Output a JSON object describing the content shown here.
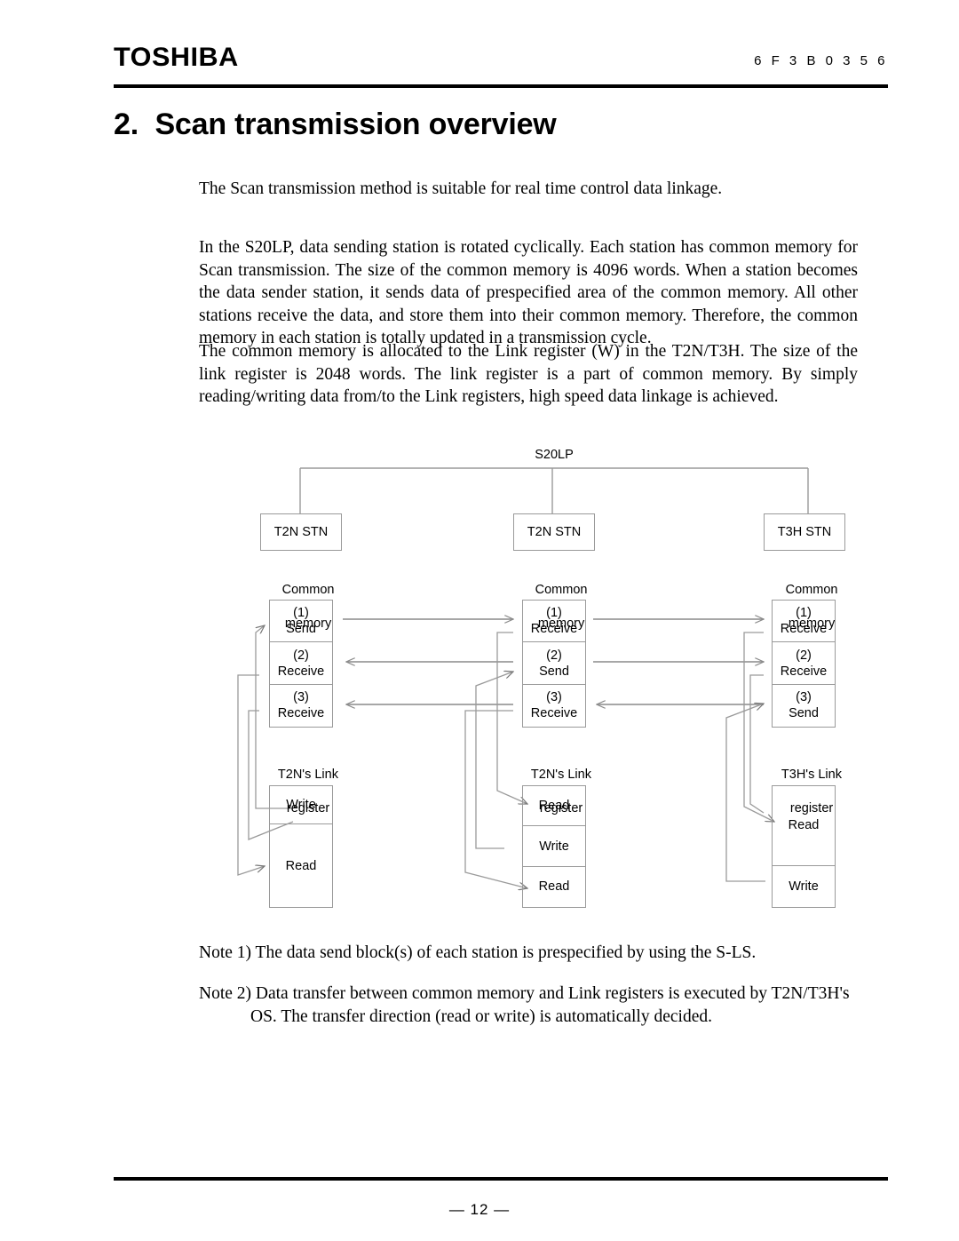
{
  "header": {
    "brand": "TOSHIBA",
    "doc_code": "6 F 3 B 0 3 5 6"
  },
  "title": "2.  Scan transmission overview",
  "paragraphs": {
    "p1": "The Scan transmission method is suitable for real time control data linkage.",
    "p2": "In the S20LP, data sending station is rotated cyclically. Each station has common memory for Scan transmission. The size of the common memory is 4096 words. When a station becomes the data sender station, it sends data of prespecified area of the common memory. All other stations receive the data, and store them into their common memory. Therefore, the common memory in each station is totally updated in a transmission cycle.",
    "p3": "The common memory is allocated to the Link register (W) in the T2N/T3H. The size of the link register is 2048 words. The link register is a part of common memory. By simply reading/writing data from/to the Link registers, high speed data linkage is achieved."
  },
  "notes": {
    "note1": "Note 1) The data send block(s) of each station is prespecified by using the S-LS.",
    "note2_line1": "Note 2) Data transfer between common memory and Link registers is executed by T2N/T3H's",
    "note2_line2": "OS. The transfer direction (read or write) is automatically decided."
  },
  "footer": {
    "page": "— 12 —"
  },
  "diagram": {
    "network_label": "S20LP",
    "columns": [
      {
        "station": "T2N   STN",
        "memory_title_line1": "Common",
        "memory_title_line2": "memory",
        "memory_cells": [
          {
            "index": "(1)",
            "op": "Send"
          },
          {
            "index": "(2)",
            "op": "Receive"
          },
          {
            "index": "(3)",
            "op": "Receive"
          }
        ],
        "register_title_line1": "T2N's Link",
        "register_title_line2": "register",
        "register_cells": [
          "Write",
          "Read"
        ]
      },
      {
        "station": "T2N   STN",
        "memory_title_line1": "Common",
        "memory_title_line2": "memory",
        "memory_cells": [
          {
            "index": "(1)",
            "op": "Receive"
          },
          {
            "index": "(2)",
            "op": "Send"
          },
          {
            "index": "(3)",
            "op": "Receive"
          }
        ],
        "register_title_line1": "T2N's Link",
        "register_title_line2": "register",
        "register_cells": [
          "Read",
          "Write",
          "Read"
        ]
      },
      {
        "station": "T3H   STN",
        "memory_title_line1": "Common",
        "memory_title_line2": "memory",
        "memory_cells": [
          {
            "index": "(1)",
            "op": "Receive"
          },
          {
            "index": "(2)",
            "op": "Receive"
          },
          {
            "index": "(3)",
            "op": "Send"
          }
        ],
        "register_title_line1": "T3H's Link",
        "register_title_line2": "register",
        "register_cells": [
          "Read",
          "Write"
        ]
      }
    ],
    "colors": {
      "line": "#9a9a9a",
      "arrow": "#8a8a8a",
      "text": "#000000"
    }
  }
}
